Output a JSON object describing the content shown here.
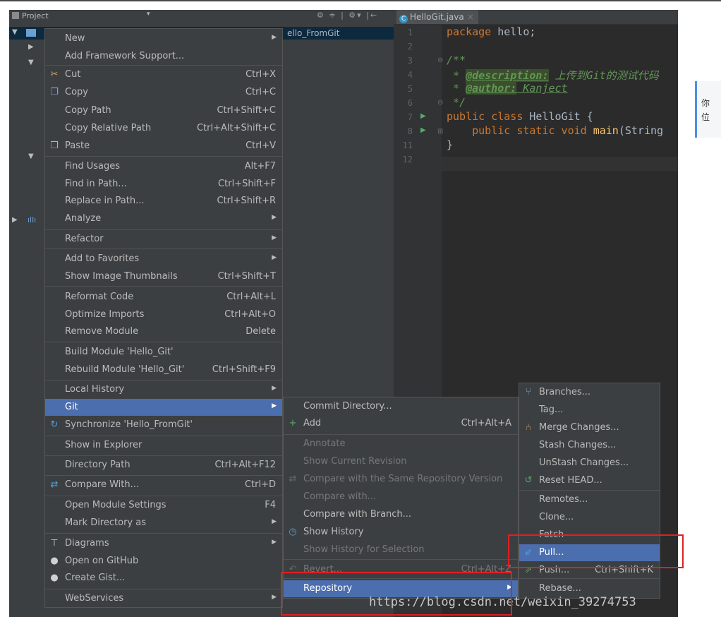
{
  "project_panel": {
    "title": "Project",
    "dropdown_arrow": "▾",
    "toolbar_glyphs": "⚙ ≑ | ⚙▾ |←",
    "selected_node_suffix": "ello_FromGit"
  },
  "editor": {
    "tab_label": "HelloGit.java",
    "tab_close": "×",
    "tab_icon": "C",
    "line_numbers": [
      "1",
      "2",
      "3",
      "4",
      "5",
      "6",
      "7",
      "8",
      "11",
      "12"
    ],
    "code": {
      "l1_kw": "package",
      "l1_rest": " hello;",
      "l3": "/**",
      "l4_star": " * ",
      "l4_tag": "@description:",
      "l4_text": " 上传到Git的测试代码",
      "l5_star": " * ",
      "l5_tag": "@author:",
      "l5_text": " Kanject",
      "l6": " */",
      "l7_kw": "public class",
      "l7_rest": " HelloGit {",
      "l8_kw": "    public static void",
      "l8_fn": " main",
      "l8_rest": "(String",
      "l11": "}"
    }
  },
  "context_menu": {
    "items": [
      {
        "label": "New",
        "shortcut": "",
        "submenu": true,
        "icon": ""
      },
      {
        "label": "Add Framework Support...",
        "shortcut": "",
        "submenu": false,
        "icon": ""
      },
      {
        "label": "Cut",
        "shortcut": "Ctrl+X",
        "submenu": false,
        "icon": "scissors-icon"
      },
      {
        "label": "Copy",
        "shortcut": "Ctrl+C",
        "submenu": false,
        "icon": "copy-icon"
      },
      {
        "label": "Copy Path",
        "shortcut": "Ctrl+Shift+C",
        "submenu": false,
        "icon": ""
      },
      {
        "label": "Copy Relative Path",
        "shortcut": "Ctrl+Alt+Shift+C",
        "submenu": false,
        "icon": ""
      },
      {
        "label": "Paste",
        "shortcut": "Ctrl+V",
        "submenu": false,
        "icon": "paste-icon"
      },
      {
        "label": "Find Usages",
        "shortcut": "Alt+F7",
        "submenu": false,
        "icon": ""
      },
      {
        "label": "Find in Path...",
        "shortcut": "Ctrl+Shift+F",
        "submenu": false,
        "icon": ""
      },
      {
        "label": "Replace in Path...",
        "shortcut": "Ctrl+Shift+R",
        "submenu": false,
        "icon": ""
      },
      {
        "label": "Analyze",
        "shortcut": "",
        "submenu": true,
        "icon": ""
      },
      {
        "label": "Refactor",
        "shortcut": "",
        "submenu": true,
        "icon": ""
      },
      {
        "label": "Add to Favorites",
        "shortcut": "",
        "submenu": true,
        "icon": ""
      },
      {
        "label": "Show Image Thumbnails",
        "shortcut": "Ctrl+Shift+T",
        "submenu": false,
        "icon": ""
      },
      {
        "label": "Reformat Code",
        "shortcut": "Ctrl+Alt+L",
        "submenu": false,
        "icon": ""
      },
      {
        "label": "Optimize Imports",
        "shortcut": "Ctrl+Alt+O",
        "submenu": false,
        "icon": ""
      },
      {
        "label": "Remove Module",
        "shortcut": "Delete",
        "submenu": false,
        "icon": ""
      },
      {
        "label": "Build Module 'Hello_Git'",
        "shortcut": "",
        "submenu": false,
        "icon": ""
      },
      {
        "label": "Rebuild Module 'Hello_Git'",
        "shortcut": "Ctrl+Shift+F9",
        "submenu": false,
        "icon": ""
      },
      {
        "label": "Local History",
        "shortcut": "",
        "submenu": true,
        "icon": ""
      },
      {
        "label": "Git",
        "shortcut": "",
        "submenu": true,
        "icon": "",
        "highlighted": true
      },
      {
        "label": "Synchronize 'Hello_FromGit'",
        "shortcut": "",
        "submenu": false,
        "icon": "sync-icon"
      },
      {
        "label": "Show in Explorer",
        "shortcut": "",
        "submenu": false,
        "icon": ""
      },
      {
        "label": "Directory Path",
        "shortcut": "Ctrl+Alt+F12",
        "submenu": false,
        "icon": ""
      },
      {
        "label": "Compare With...",
        "shortcut": "Ctrl+D",
        "submenu": false,
        "icon": "compare-icon"
      },
      {
        "label": "Open Module Settings",
        "shortcut": "F4",
        "submenu": false,
        "icon": ""
      },
      {
        "label": "Mark Directory as",
        "shortcut": "",
        "submenu": true,
        "icon": ""
      },
      {
        "label": "Diagrams",
        "shortcut": "",
        "submenu": true,
        "icon": "diagram-icon"
      },
      {
        "label": "Open on GitHub",
        "shortcut": "",
        "submenu": false,
        "icon": "github-icon"
      },
      {
        "label": "Create Gist...",
        "shortcut": "",
        "submenu": false,
        "icon": "github-icon"
      },
      {
        "label": "WebServices",
        "shortcut": "",
        "submenu": true,
        "icon": ""
      }
    ]
  },
  "git_menu": {
    "items": [
      {
        "label": "Commit Directory...",
        "shortcut": "",
        "icon": "",
        "disabled": false
      },
      {
        "label": "Add",
        "shortcut": "Ctrl+Alt+A",
        "icon": "plus-icon",
        "disabled": false
      },
      {
        "label": "Annotate",
        "shortcut": "",
        "icon": "",
        "disabled": true
      },
      {
        "label": "Show Current Revision",
        "shortcut": "",
        "icon": "",
        "disabled": true
      },
      {
        "label": "Compare with the Same Repository Version",
        "shortcut": "",
        "icon": "compare-icon",
        "disabled": true
      },
      {
        "label": "Compare with...",
        "shortcut": "",
        "icon": "",
        "disabled": true
      },
      {
        "label": "Compare with Branch...",
        "shortcut": "",
        "icon": "",
        "disabled": false
      },
      {
        "label": "Show History",
        "shortcut": "",
        "icon": "history-icon",
        "disabled": false
      },
      {
        "label": "Show History for Selection",
        "shortcut": "",
        "icon": "",
        "disabled": true
      },
      {
        "label": "Revert...",
        "shortcut": "Ctrl+Alt+Z",
        "icon": "revert-icon",
        "disabled": true
      },
      {
        "label": "Repository",
        "shortcut": "",
        "icon": "",
        "disabled": false,
        "highlighted": true,
        "submenu": true
      }
    ]
  },
  "repo_menu": {
    "items": [
      {
        "label": "Branches...",
        "shortcut": "",
        "icon": "branch-icon"
      },
      {
        "label": "Tag...",
        "shortcut": "",
        "icon": ""
      },
      {
        "label": "Merge Changes...",
        "shortcut": "",
        "icon": "merge-icon"
      },
      {
        "label": "Stash Changes...",
        "shortcut": "",
        "icon": ""
      },
      {
        "label": "UnStash Changes...",
        "shortcut": "",
        "icon": ""
      },
      {
        "label": "Reset HEAD...",
        "shortcut": "",
        "icon": "reset-icon"
      },
      {
        "label": "Remotes...",
        "shortcut": "",
        "icon": ""
      },
      {
        "label": "Clone...",
        "shortcut": "",
        "icon": ""
      },
      {
        "label": "Fetch",
        "shortcut": "",
        "icon": ""
      },
      {
        "label": "Pull...",
        "shortcut": "",
        "icon": "pull-icon",
        "highlighted": true
      },
      {
        "label": "Push...",
        "shortcut": "Ctrl+Shift+K",
        "icon": "push-icon"
      },
      {
        "label": "Rebase...",
        "shortcut": "",
        "icon": ""
      }
    ]
  },
  "watermark": "https://blog.csdn.net/weixin_39274753",
  "side_note": {
    "line1": "你",
    "line2": "位"
  },
  "colors": {
    "highlight": "#4b6eaf",
    "annotation_box": "#e02020",
    "menu_bg": "#3c3f41"
  }
}
